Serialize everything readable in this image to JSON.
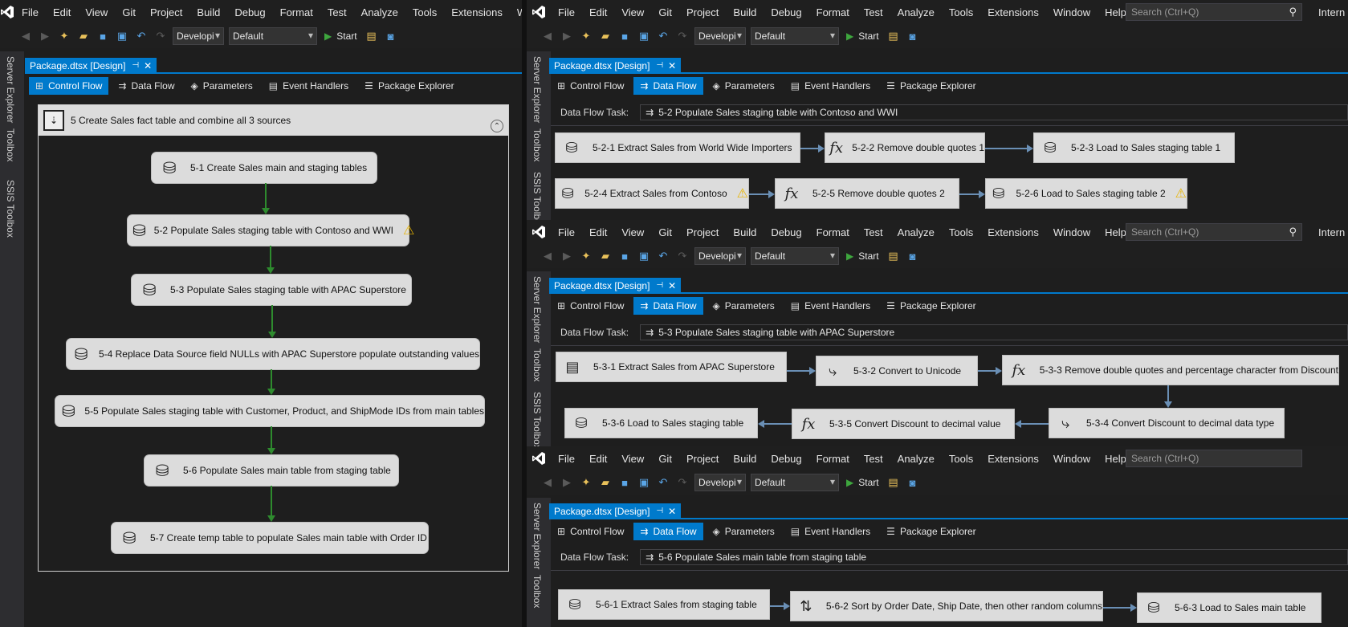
{
  "menu": {
    "items": [
      "File",
      "Edit",
      "View",
      "Git",
      "Project",
      "Build",
      "Debug",
      "Format",
      "Test",
      "Analyze",
      "Tools",
      "Extensions",
      "Window",
      "Help"
    ],
    "items_left_partial": [
      "File",
      "Edit",
      "View",
      "Git",
      "Project",
      "Build",
      "Debug",
      "Format",
      "Test",
      "Analyze",
      "Tools",
      "Extensions",
      "W"
    ],
    "search_placeholder": "Search (Ctrl+Q)",
    "trailing_1": "Intern",
    "trailing_2": "Intern"
  },
  "toolbar": {
    "config": "Developi",
    "platform": "Default",
    "start": "Start"
  },
  "sidebar": {
    "server_explorer": "Server Explorer",
    "toolbox": "Toolbox",
    "ssis_toolbox": "SSIS Toolbox"
  },
  "doc_tab": {
    "label": "Package.dtsx [Design]",
    "pin": "⊣",
    "close": "✕"
  },
  "design_tabs": {
    "control_flow": "Control Flow",
    "data_flow": "Data Flow",
    "parameters": "Parameters",
    "event_handlers": "Event Handlers",
    "package_explorer": "Package Explorer"
  },
  "control_flow": {
    "container_title": "5  Create Sales fact table and combine all 3 sources",
    "tasks": [
      "5-1  Create Sales main and staging tables",
      "5-2  Populate Sales staging table with Contoso and WWI",
      "5-3  Populate Sales staging table with APAC Superstore",
      "5-4  Replace Data Source field NULLs with APAC Superstore populate outstanding values",
      "5-5  Populate Sales staging table with Customer, Product, and ShipMode IDs from main tables",
      "5-6  Populate Sales main table from staging table",
      "5-7  Create temp table to populate Sales main table with Order ID"
    ]
  },
  "df1": {
    "task_label": "Data Flow Task:",
    "task_value": "5-2  Populate Sales staging table with Contoso and WWI",
    "c1": "5-2-1  Extract Sales from World Wide Importers",
    "c2": "5-2-2  Remove double quotes 1",
    "c3": "5-2-3  Load to Sales staging table 1",
    "c4": "5-2-4  Extract Sales from Contoso",
    "c5": "5-2-5  Remove double quotes 2",
    "c6": "5-2-6  Load to Sales staging table 2"
  },
  "df2": {
    "task_label": "Data Flow Task:",
    "task_value": "5-3  Populate Sales staging table with APAC Superstore",
    "c1": "5-3-1  Extract Sales from APAC Superstore",
    "c2": "5-3-2  Convert to Unicode",
    "c3": "5-3-3  Remove double quotes and percentage character from Discount",
    "c4": "5-3-4  Convert Discount to decimal data type",
    "c5": "5-3-5  Convert Discount to decimal value",
    "c6": "5-3-6  Load to Sales staging table"
  },
  "df3": {
    "task_label": "Data Flow Task:",
    "task_value": "5-6  Populate Sales main table from staging table",
    "c1": "5-6-1  Extract Sales from staging table",
    "c2": "5-6-2  Sort by Order Date, Ship Date, then other random columns",
    "c3": "5-6-3  Load to Sales main table"
  },
  "icons": {
    "vs_logo": "visual-studio-logo",
    "database": "database-icon",
    "warning": "warning-icon",
    "fx": "fx",
    "sort": "⇅"
  },
  "colors": {
    "accent": "#007acc",
    "precedence": "#2e8b2e",
    "dataflow_path": "#6a8fb5",
    "warning": "#e8b400"
  }
}
